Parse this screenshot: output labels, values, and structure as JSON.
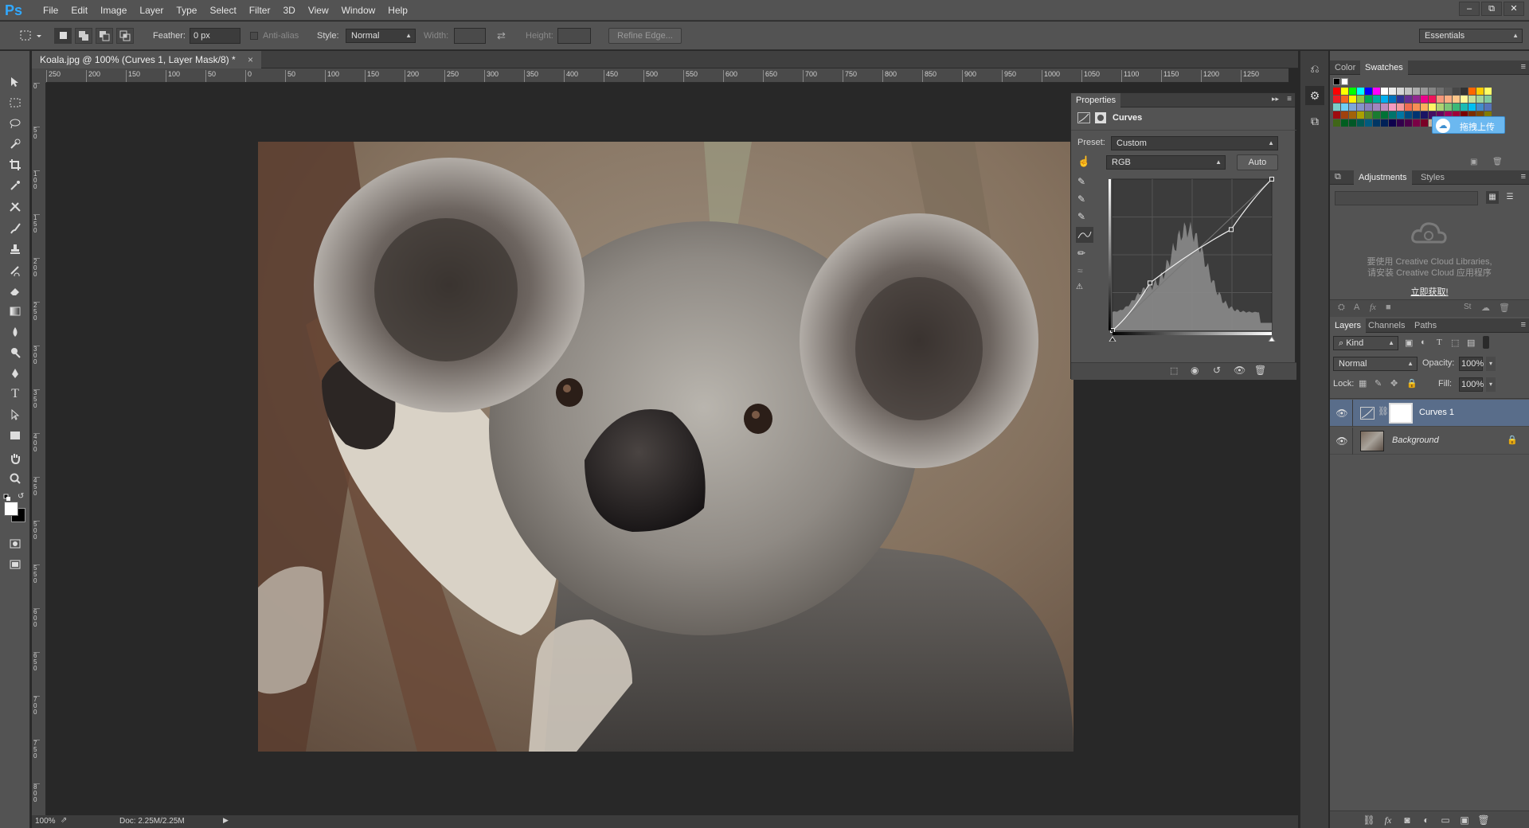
{
  "app": {
    "logo": "Ps"
  },
  "menu": [
    "File",
    "Edit",
    "Image",
    "Layer",
    "Type",
    "Select",
    "Filter",
    "3D",
    "View",
    "Window",
    "Help"
  ],
  "window_controls": [
    "–",
    "⧉",
    "✕"
  ],
  "options": {
    "feather_label": "Feather:",
    "feather_value": "0 px",
    "antialias_label": "Anti-alias",
    "style_label": "Style:",
    "style_value": "Normal",
    "width_label": "Width:",
    "height_label": "Height:",
    "refine_edge": "Refine Edge...",
    "workspace": "Essentials"
  },
  "document": {
    "tab_title": "Koala.jpg @ 100% (Curves 1, Layer Mask/8) *",
    "close": "×",
    "zoom": "100%",
    "doc_size": "Doc: 2.25M/2.25M"
  },
  "rulers": {
    "h_ticks": [
      "250",
      "200",
      "150",
      "100",
      "50",
      "0",
      "50",
      "100",
      "150",
      "200",
      "250",
      "300",
      "350",
      "400",
      "450",
      "500",
      "550",
      "600",
      "650",
      "700",
      "750",
      "800",
      "850",
      "900",
      "950",
      "1000",
      "1050",
      "1100",
      "1150",
      "1200",
      "1250"
    ],
    "v_ticks": [
      "0",
      "5 0",
      "1 0 0",
      "1 5 0",
      "2 0 0",
      "2 5 0",
      "3 0 0",
      "3 5 0",
      "4 0 0",
      "4 5 0",
      "5 0 0",
      "5 5 0",
      "6 0 0",
      "6 5 0",
      "7 0 0",
      "7 5 0",
      "8 0 0"
    ]
  },
  "properties": {
    "tab": "Properties",
    "title": "Curves",
    "preset_label": "Preset:",
    "preset_value": "Custom",
    "channel_value": "RGB",
    "auto_button": "Auto"
  },
  "curve": {
    "points": [
      [
        0,
        0
      ],
      [
        60,
        80
      ],
      [
        190,
        170
      ],
      [
        255,
        255
      ]
    ]
  },
  "color_panel": {
    "tabs": [
      "Color",
      "Swatches"
    ],
    "overlay_text": "拖拽上传"
  },
  "adjustments_panel": {
    "tabs": [
      "Adjustments",
      "Styles"
    ],
    "cc_line1": "要使用 Creative Cloud Libraries,",
    "cc_line2": "请安装 Creative Cloud 应用程序",
    "cc_link": "立即获取!"
  },
  "layers_panel": {
    "tabs": [
      "Layers",
      "Channels",
      "Paths"
    ],
    "kind_label": "Kind",
    "blend_mode": "Normal",
    "opacity_label": "Opacity:",
    "opacity_value": "100%",
    "lock_label": "Lock:",
    "fill_label": "Fill:",
    "fill_value": "100%",
    "layers": [
      {
        "name": "Curves 1",
        "selected": true
      },
      {
        "name": "Background",
        "selected": false
      }
    ]
  },
  "colors": {
    "accent": "#31a8ff",
    "selected_layer": "#596d8a",
    "ui_bg": "#535353"
  }
}
